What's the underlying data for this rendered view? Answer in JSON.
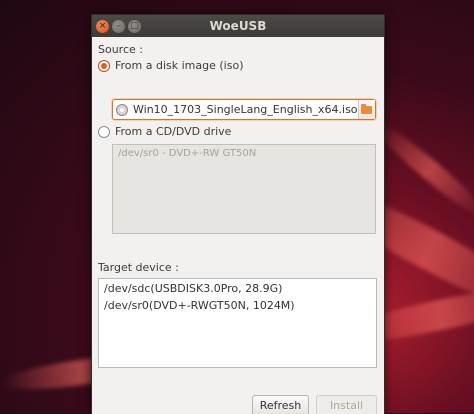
{
  "window": {
    "title": "WoeUSB"
  },
  "source": {
    "label": "Source :",
    "from_image_label": "From a disk image (iso)",
    "from_image_selected": true,
    "iso_file": "Win10_1703_SingleLang_English_x64.iso",
    "from_drive_label": "From a CD/DVD drive",
    "from_drive_selected": false,
    "drives": [
      "/dev/sr0 - DVD+-RW GT50N"
    ]
  },
  "target": {
    "label": "Target device :",
    "devices": [
      "/dev/sdc(USBDISK3.0Pro, 28.9G)",
      "/dev/sr0(DVD+-RWGT50N, 1024M)"
    ]
  },
  "buttons": {
    "refresh": "Refresh",
    "install": "Install"
  },
  "colors": {
    "accent": "#e05a1f",
    "titlebar": "#3c3b37",
    "window_bg": "#f2f1f0"
  }
}
